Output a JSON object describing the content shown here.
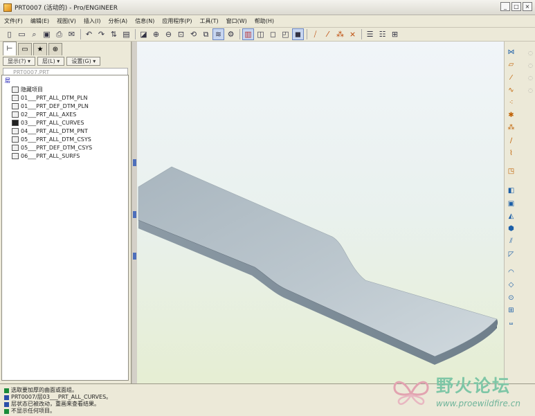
{
  "window": {
    "title": "PRT0007 (活动的) - Pro/ENGINEER",
    "controls": [
      "_",
      "□",
      "×"
    ]
  },
  "menubar": {
    "items": [
      "文件(F)",
      "编辑(E)",
      "视图(V)",
      "插入(I)",
      "分析(A)",
      "信息(N)",
      "应用程序(P)",
      "工具(T)",
      "窗口(W)",
      "帮助(H)"
    ]
  },
  "toolbar": {
    "icons": [
      "new-icon",
      "open-icon",
      "find-icon",
      "save-icon",
      "print-icon",
      "email-icon",
      "undo-icon",
      "redo-icon",
      "regenerate-icon",
      "select-filter-icon",
      "repaint-icon",
      "zoom-in-icon",
      "zoom-out-icon",
      "refit-icon",
      "reorient-icon",
      "saved-view-icon",
      "layers-icon",
      "settings-icon",
      "shading-icon",
      "hidden-line-icon",
      "no-hidden-icon",
      "wireframe-icon",
      "shaded-icon",
      "datum-plane-icon",
      "datum-axis-icon",
      "datum-point-icon",
      "coordinate-system-icon",
      "layer-tree-icon",
      "model-tree-icon",
      "find-feature-icon"
    ]
  },
  "left_panel": {
    "tabs": [
      "model-tree-tab",
      "folder-tab",
      "favorites-tab",
      "connections-tab"
    ],
    "buttons": {
      "show": "显示(?) ▾",
      "layer": "层(L) ▾",
      "settings": "设置(G) ▾"
    },
    "filter_text": "PRT0007.PRT",
    "tree_root": "层",
    "tree_items": [
      "隐藏项目",
      "01___PRT_ALL_DTM_PLN",
      "01___PRT_DEF_DTM_PLN",
      "02___PRT_ALL_AXES",
      "03___PRT_ALL_CURVES",
      "04___PRT_ALL_DTM_PNT",
      "05___PRT_ALL_DTM_CSYS",
      "05___PRT_DEF_DTM_CSYS",
      "06___PRT_ALL_SURFS"
    ]
  },
  "messages": [
    "选取要加厚的曲面或面组。",
    "PRT0007/层03___PRT_ALL_CURVES。",
    "层状态已被改动，重画来查看结果。",
    "不显示任何项目。"
  ],
  "watermark": {
    "title": "野火论坛",
    "url": "www.proewildfire.cn"
  },
  "colors": {
    "part_top": "#b8c4cb",
    "part_side": "#7d8c98",
    "viewport_top": "#f1f5f9",
    "viewport_bottom": "#e6eed3",
    "accent": "#4d6fbb"
  }
}
